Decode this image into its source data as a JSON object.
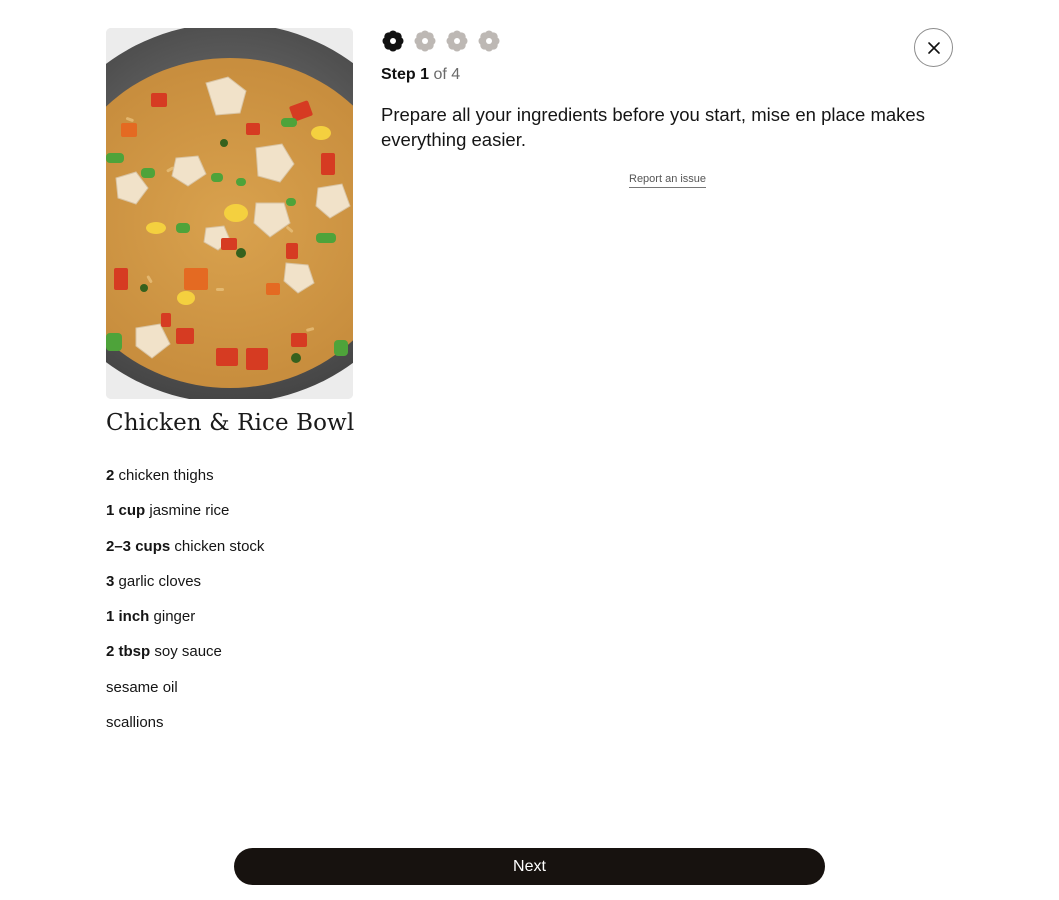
{
  "recipe": {
    "photo_icon": "fried-rice-photo",
    "title": "Chicken & Rice Bowl",
    "ingredients": [
      {
        "qty": "2",
        "name": "chicken thighs"
      },
      {
        "qty": "1 cup",
        "name": "jasmine rice"
      },
      {
        "qty": "2–3 cups",
        "name": "chicken stock"
      },
      {
        "qty": "3",
        "name": "garlic cloves"
      },
      {
        "qty": "1 inch",
        "name": "ginger"
      },
      {
        "qty": "2 tbsp",
        "name": "soy sauce"
      },
      {
        "qty": "",
        "name": "sesame oil"
      },
      {
        "qty": "",
        "name": "scallions"
      }
    ]
  },
  "progress": {
    "icon": "flower-icon",
    "total_steps": 4,
    "current_step": 1,
    "active_color": "#111111",
    "inactive_color": "#bdb8b4"
  },
  "step": {
    "label": "Step 1",
    "of_text": "of 4",
    "instruction": "Prepare all your ingredients before you start, mise en place makes everything easier.",
    "report_link": "Report an issue"
  },
  "close_icon": "close-icon",
  "next_button_label": "Next",
  "colors": {
    "button_bg": "#17120f",
    "button_text": "#ffffff"
  }
}
